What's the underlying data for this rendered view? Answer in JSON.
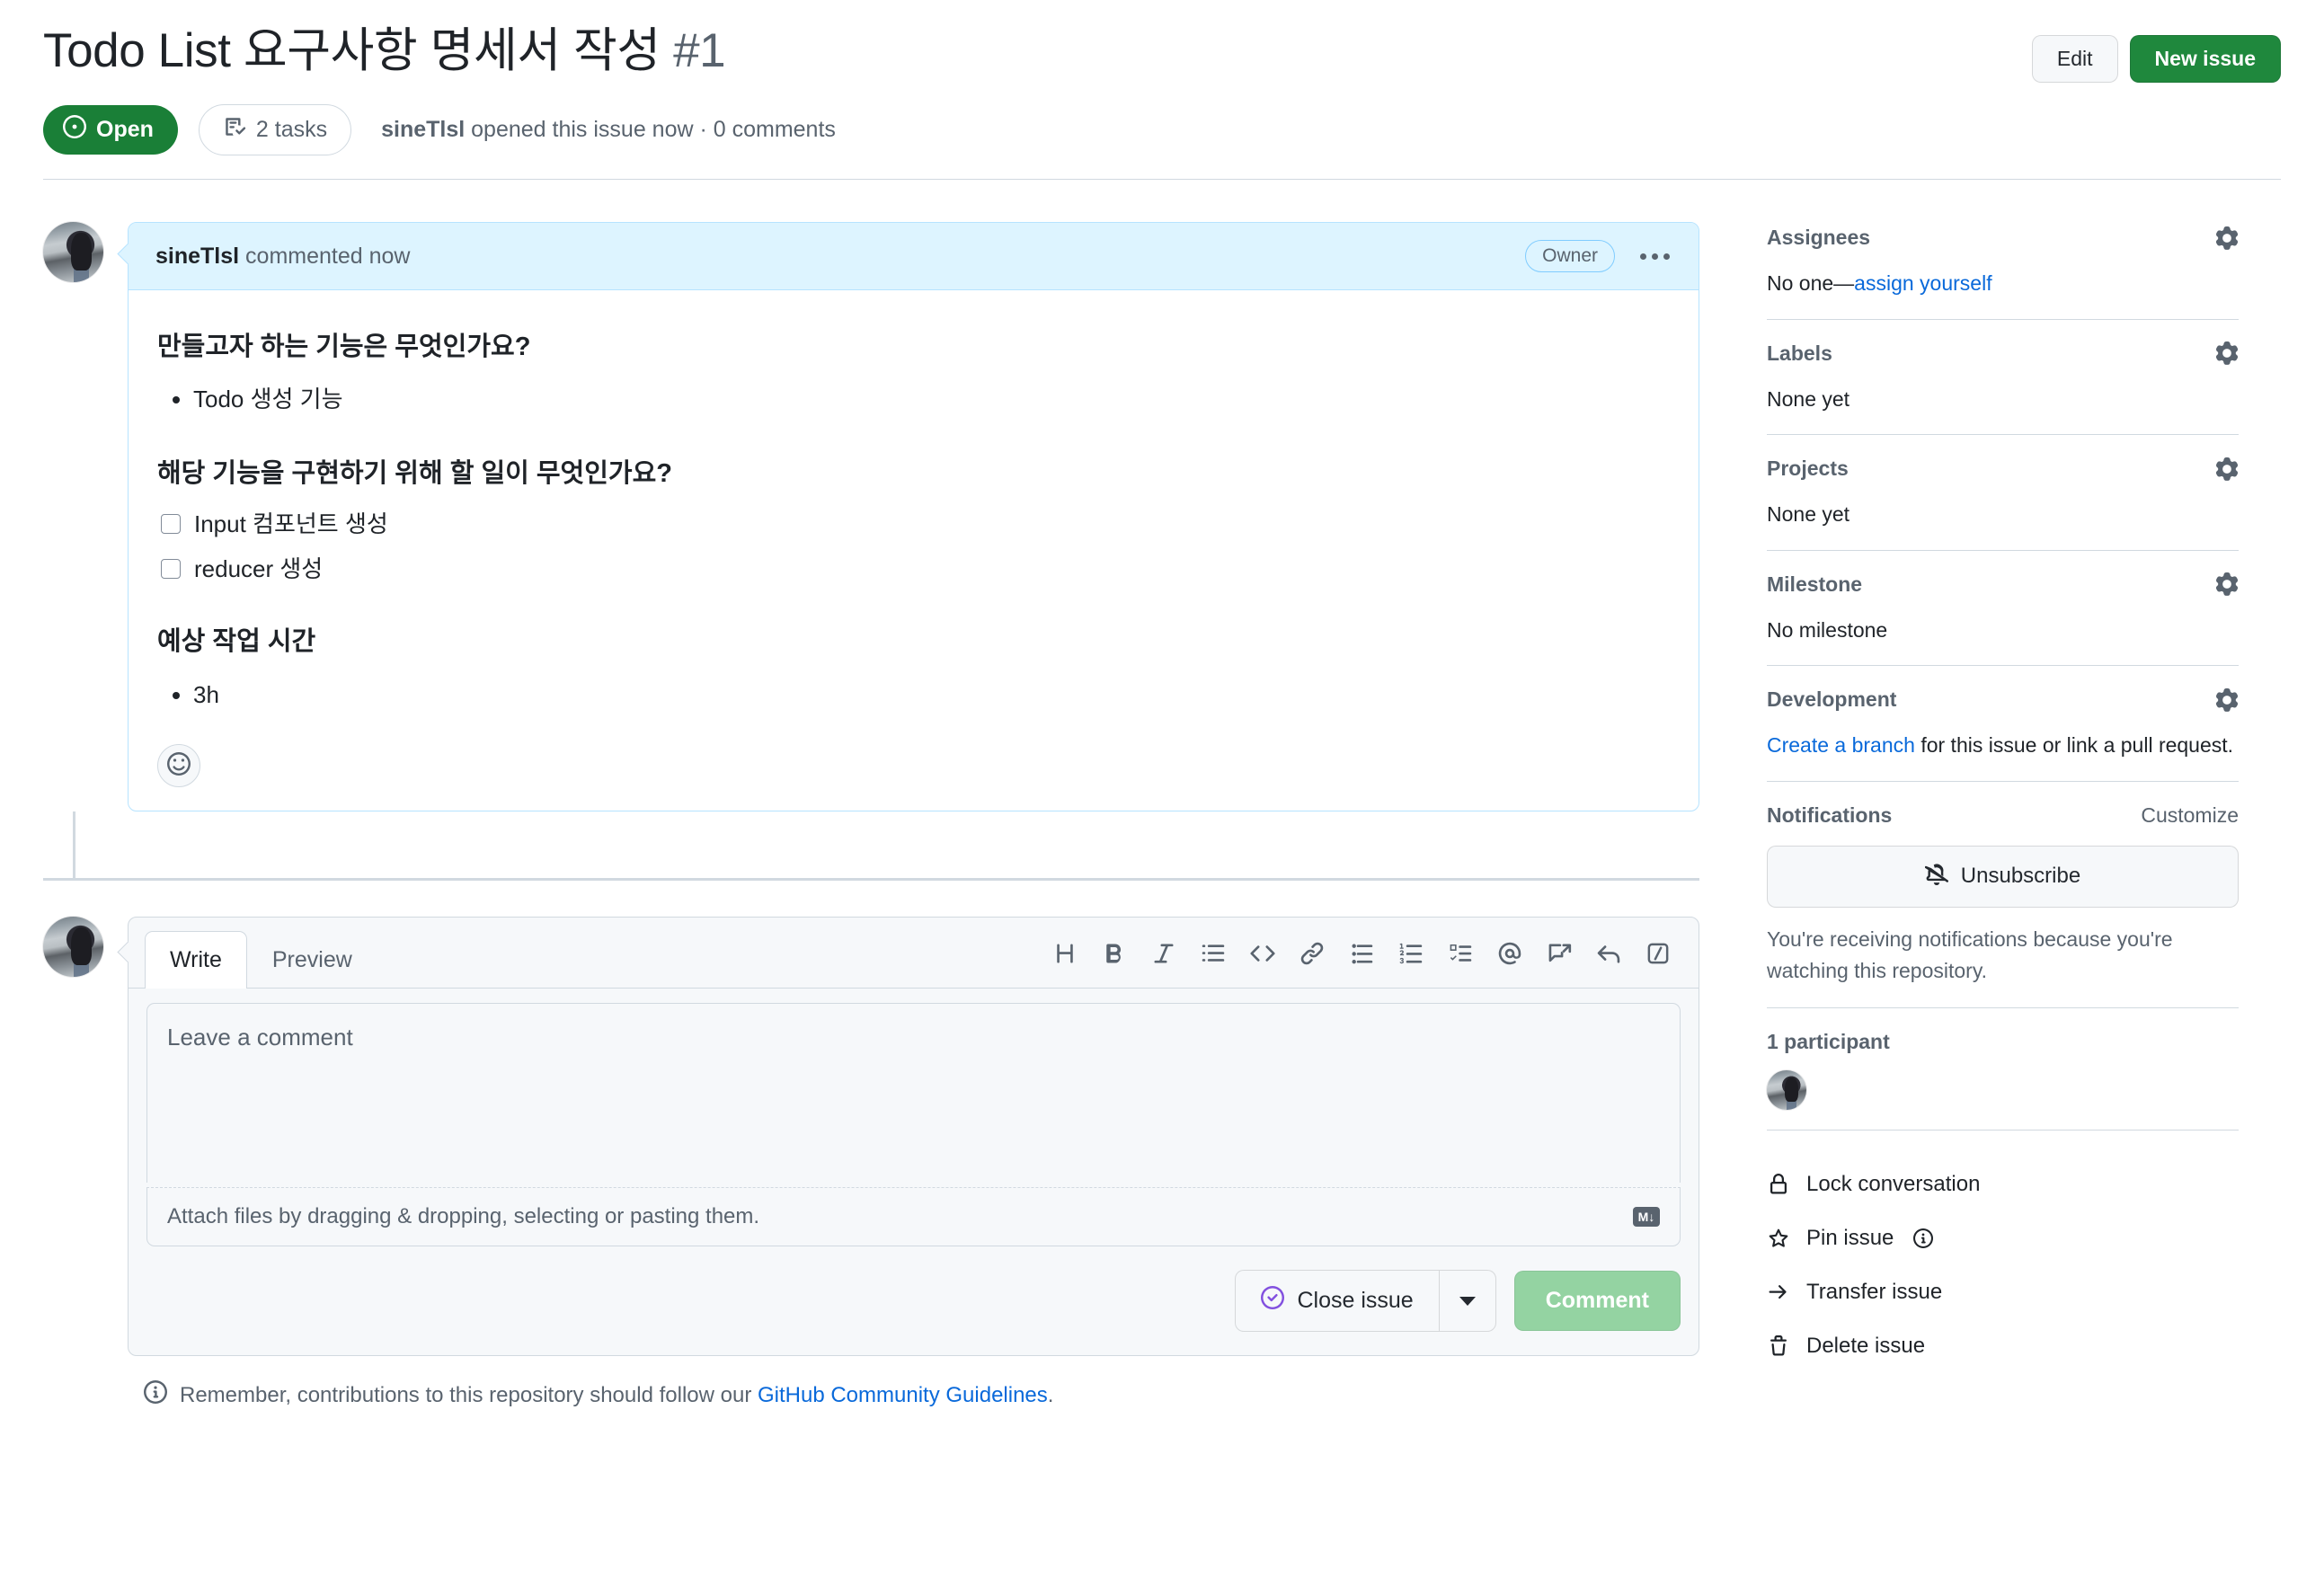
{
  "header": {
    "title": "Todo List 요구사항 명세서 작성",
    "issue_number": "#1",
    "edit_label": "Edit",
    "new_issue_label": "New issue",
    "state": "Open",
    "tasks_badge": "2 tasks",
    "meta_author": "sineTlsl",
    "meta_rest": " opened this issue now · 0 comments"
  },
  "comment": {
    "author": "sineTlsl",
    "action": " commented now",
    "role_badge": "Owner",
    "sections": [
      {
        "heading": "만들고자 하는 기능은 무엇인가요?",
        "bullets": [
          "Todo 생성 기능"
        ]
      },
      {
        "heading": "해당 기능을 구현하기 위해 할 일이 무엇인가요?",
        "tasks": [
          "Input 컴포넌트 생성",
          "reducer 생성"
        ]
      },
      {
        "heading": "예상 작업 시간",
        "bullets": [
          "3h"
        ]
      }
    ]
  },
  "editor": {
    "tabs": [
      {
        "label": "Write",
        "active": true
      },
      {
        "label": "Preview",
        "active": false
      }
    ],
    "toolbar": [
      "heading-icon",
      "bold-icon",
      "italic-icon",
      "quote-icon",
      "code-icon",
      "link-icon",
      "unordered-list-icon",
      "ordered-list-icon",
      "task-list-icon",
      "mention-icon",
      "reference-icon",
      "reply-icon",
      "slash-command-icon"
    ],
    "placeholder": "Leave a comment",
    "value": "",
    "attach_hint": "Attach files by dragging & dropping, selecting or pasting them.",
    "markdown_badge": "M↓",
    "close_issue_label": "Close issue",
    "comment_label": "Comment",
    "guidelines_prefix": "Remember, contributions to this repository should follow our ",
    "guidelines_link": "GitHub Community Guidelines",
    "guidelines_suffix": "."
  },
  "sidebar": {
    "assignees": {
      "title": "Assignees",
      "value_plain": "No one—",
      "value_link": "assign yourself"
    },
    "labels": {
      "title": "Labels",
      "value": "None yet"
    },
    "projects": {
      "title": "Projects",
      "value": "None yet"
    },
    "milestone": {
      "title": "Milestone",
      "value": "No milestone"
    },
    "development": {
      "title": "Development",
      "link": "Create a branch",
      "rest": " for this issue or link a pull request."
    },
    "notifications": {
      "title": "Notifications",
      "customize": "Customize",
      "unsubscribe": "Unsubscribe",
      "note": "You're receiving notifications because you're watching this repository."
    },
    "participants": {
      "title": "1 participant"
    },
    "actions": [
      {
        "label": "Lock conversation",
        "icon": "lock-icon"
      },
      {
        "label": "Pin issue",
        "icon": "pin-icon",
        "info": true
      },
      {
        "label": "Transfer issue",
        "icon": "arrow-right-icon"
      },
      {
        "label": "Delete issue",
        "icon": "trash-icon"
      }
    ]
  },
  "colors": {
    "open_green": "#1a7f37",
    "new_issue_green": "#1f883d",
    "comment_green_disabled": "#94d3a2",
    "link_blue": "#0969da",
    "header_blue_bg": "#ddf4ff",
    "header_blue_border": "#b6e3ff",
    "close_purple": "#8250df",
    "muted": "#59636e"
  }
}
